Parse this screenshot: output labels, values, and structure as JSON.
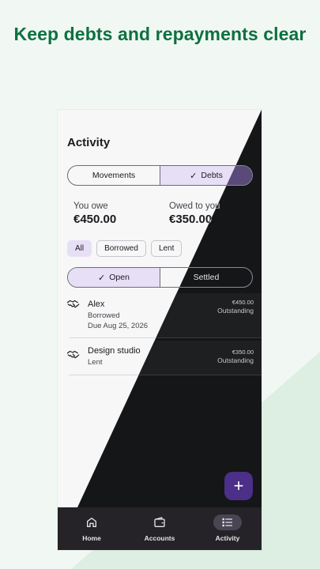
{
  "headline": "Keep debts and repayments clear",
  "app": {
    "title": "Activity",
    "top_tabs": [
      {
        "label": "Movements",
        "selected": false
      },
      {
        "label": "Debts",
        "selected": true
      }
    ],
    "summary": {
      "you_owe_label": "You owe",
      "you_owe_value": "€450.00",
      "owed_to_you_label": "Owed to you",
      "owed_to_you_value": "€350.00"
    },
    "filter_chips": [
      {
        "label": "All",
        "selected": true
      },
      {
        "label": "Borrowed",
        "selected": false
      },
      {
        "label": "Lent",
        "selected": false
      }
    ],
    "status_tabs": [
      {
        "label": "Open",
        "selected": true
      },
      {
        "label": "Settled",
        "selected": false
      }
    ],
    "debts": [
      {
        "name": "Alex",
        "type": "Borrowed",
        "due": "Due Aug 25, 2026",
        "amount": "€450.00",
        "status": "Outstanding",
        "icon": "handshake-icon"
      },
      {
        "name": "Design studio",
        "type": "Lent",
        "due": "",
        "amount": "€350.00",
        "status": "Outstanding",
        "icon": "handshake-icon"
      }
    ],
    "fab_label": "+",
    "nav": [
      {
        "label": "Home",
        "icon": "home-icon",
        "selected": false
      },
      {
        "label": "Accounts",
        "icon": "wallet-icon",
        "selected": false
      },
      {
        "label": "Activity",
        "icon": "list-icon",
        "selected": true
      }
    ]
  },
  "colors": {
    "background": "#f1f8f3",
    "headline": "#0e7040",
    "accent": "#4b2f88",
    "selected_tint": "#e7dff5",
    "dark_half": "#141617"
  }
}
